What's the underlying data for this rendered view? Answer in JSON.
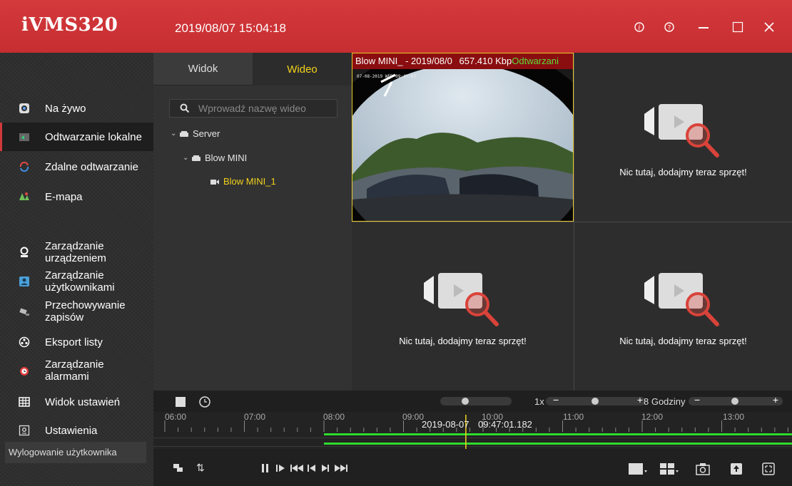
{
  "app": {
    "title": "iVMS320",
    "datetime": "2019/08/07 15:04:18"
  },
  "titlebar_icons": [
    "info-icon",
    "help-icon",
    "minimize-icon",
    "maximize-icon",
    "close-icon"
  ],
  "colors": {
    "brand_red": "#c8323a",
    "accent_yellow": "#f3d21c",
    "record_green": "#2ddc2d"
  },
  "nav": {
    "items": [
      {
        "label": "Na żywo",
        "icon": "live-view-icon"
      },
      {
        "label": "Odtwarzanie lokalne",
        "icon": "local-playback-icon",
        "active": true
      },
      {
        "label": "Zdalne odtwarzanie",
        "icon": "remote-playback-icon"
      },
      {
        "label": "E-mapa",
        "icon": "emap-icon"
      },
      {
        "label": "Zarządzanie urządzeniem",
        "icon": "device-management-icon"
      },
      {
        "label": "Zarządzanie użytkownikami",
        "icon": "user-management-icon"
      },
      {
        "label": "Przechowywanie zapisów",
        "icon": "storage-icon"
      },
      {
        "label": "Eksport listy",
        "icon": "export-list-icon"
      },
      {
        "label": "Zarządzanie alarmami",
        "icon": "alarm-icon"
      },
      {
        "label": "Widok ustawień",
        "icon": "view-settings-icon"
      },
      {
        "label": "Ustawienia",
        "icon": "settings-icon"
      }
    ],
    "logout_label": "Wylogowanie użytkownika"
  },
  "resources": {
    "tabs": [
      {
        "label": "Widok"
      },
      {
        "label": "Wideo",
        "active": true
      }
    ],
    "search_placeholder": "Wprowadź nazwę wideo",
    "tree": {
      "root": "Server",
      "group": "Blow MINI",
      "channel": "Blow MINI_1"
    }
  },
  "video": {
    "osd": {
      "name": "Blow MINI_",
      "date": "- 2019/08/0",
      "rate": "657.410 Kbp",
      "status": "Odtwarzani"
    },
    "empty_text": "Nic tutaj, dodajmy teraz sprzęt!"
  },
  "timeline": {
    "speed": "1x",
    "span": "8 Godziny",
    "hours": [
      "06:00",
      "07:00",
      "08:00",
      "09:00",
      "10:00",
      "11:00",
      "12:00",
      "13:00"
    ],
    "cursor_date": "2019-08-07",
    "cursor_time": "09:47:01.182",
    "recording_start": "08:00"
  }
}
